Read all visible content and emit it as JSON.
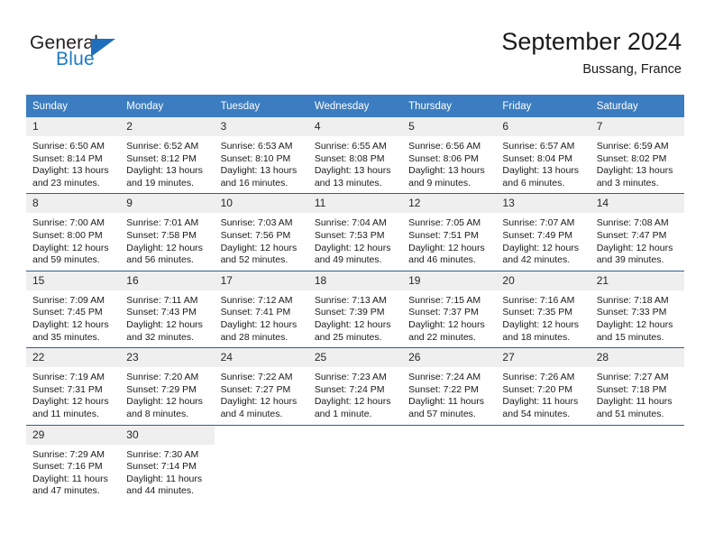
{
  "brand": {
    "name_top": "General",
    "name_bottom": "Blue",
    "color_dark": "#231f20",
    "color_blue": "#1f7ac4",
    "triangle_color": "#1f6fbd"
  },
  "header": {
    "title": "September 2024",
    "subtitle": "Bussang, France"
  },
  "theme": {
    "header_row_bg": "#3b7dc0",
    "header_row_text": "#ffffff",
    "daynum_bg": "#efefef",
    "row_divider": "#2f5f90"
  },
  "weekday_headers": [
    "Sunday",
    "Monday",
    "Tuesday",
    "Wednesday",
    "Thursday",
    "Friday",
    "Saturday"
  ],
  "labels": {
    "sunrise_prefix": "Sunrise:",
    "sunset_prefix": "Sunset:",
    "daylight_prefix": "Daylight:"
  },
  "weeks": [
    [
      {
        "day": "1",
        "sunrise": "Sunrise: 6:50 AM",
        "sunset": "Sunset: 8:14 PM",
        "daylight": "Daylight: 13 hours and 23 minutes."
      },
      {
        "day": "2",
        "sunrise": "Sunrise: 6:52 AM",
        "sunset": "Sunset: 8:12 PM",
        "daylight": "Daylight: 13 hours and 19 minutes."
      },
      {
        "day": "3",
        "sunrise": "Sunrise: 6:53 AM",
        "sunset": "Sunset: 8:10 PM",
        "daylight": "Daylight: 13 hours and 16 minutes."
      },
      {
        "day": "4",
        "sunrise": "Sunrise: 6:55 AM",
        "sunset": "Sunset: 8:08 PM",
        "daylight": "Daylight: 13 hours and 13 minutes."
      },
      {
        "day": "5",
        "sunrise": "Sunrise: 6:56 AM",
        "sunset": "Sunset: 8:06 PM",
        "daylight": "Daylight: 13 hours and 9 minutes."
      },
      {
        "day": "6",
        "sunrise": "Sunrise: 6:57 AM",
        "sunset": "Sunset: 8:04 PM",
        "daylight": "Daylight: 13 hours and 6 minutes."
      },
      {
        "day": "7",
        "sunrise": "Sunrise: 6:59 AM",
        "sunset": "Sunset: 8:02 PM",
        "daylight": "Daylight: 13 hours and 3 minutes."
      }
    ],
    [
      {
        "day": "8",
        "sunrise": "Sunrise: 7:00 AM",
        "sunset": "Sunset: 8:00 PM",
        "daylight": "Daylight: 12 hours and 59 minutes."
      },
      {
        "day": "9",
        "sunrise": "Sunrise: 7:01 AM",
        "sunset": "Sunset: 7:58 PM",
        "daylight": "Daylight: 12 hours and 56 minutes."
      },
      {
        "day": "10",
        "sunrise": "Sunrise: 7:03 AM",
        "sunset": "Sunset: 7:56 PM",
        "daylight": "Daylight: 12 hours and 52 minutes."
      },
      {
        "day": "11",
        "sunrise": "Sunrise: 7:04 AM",
        "sunset": "Sunset: 7:53 PM",
        "daylight": "Daylight: 12 hours and 49 minutes."
      },
      {
        "day": "12",
        "sunrise": "Sunrise: 7:05 AM",
        "sunset": "Sunset: 7:51 PM",
        "daylight": "Daylight: 12 hours and 46 minutes."
      },
      {
        "day": "13",
        "sunrise": "Sunrise: 7:07 AM",
        "sunset": "Sunset: 7:49 PM",
        "daylight": "Daylight: 12 hours and 42 minutes."
      },
      {
        "day": "14",
        "sunrise": "Sunrise: 7:08 AM",
        "sunset": "Sunset: 7:47 PM",
        "daylight": "Daylight: 12 hours and 39 minutes."
      }
    ],
    [
      {
        "day": "15",
        "sunrise": "Sunrise: 7:09 AM",
        "sunset": "Sunset: 7:45 PM",
        "daylight": "Daylight: 12 hours and 35 minutes."
      },
      {
        "day": "16",
        "sunrise": "Sunrise: 7:11 AM",
        "sunset": "Sunset: 7:43 PM",
        "daylight": "Daylight: 12 hours and 32 minutes."
      },
      {
        "day": "17",
        "sunrise": "Sunrise: 7:12 AM",
        "sunset": "Sunset: 7:41 PM",
        "daylight": "Daylight: 12 hours and 28 minutes."
      },
      {
        "day": "18",
        "sunrise": "Sunrise: 7:13 AM",
        "sunset": "Sunset: 7:39 PM",
        "daylight": "Daylight: 12 hours and 25 minutes."
      },
      {
        "day": "19",
        "sunrise": "Sunrise: 7:15 AM",
        "sunset": "Sunset: 7:37 PM",
        "daylight": "Daylight: 12 hours and 22 minutes."
      },
      {
        "day": "20",
        "sunrise": "Sunrise: 7:16 AM",
        "sunset": "Sunset: 7:35 PM",
        "daylight": "Daylight: 12 hours and 18 minutes."
      },
      {
        "day": "21",
        "sunrise": "Sunrise: 7:18 AM",
        "sunset": "Sunset: 7:33 PM",
        "daylight": "Daylight: 12 hours and 15 minutes."
      }
    ],
    [
      {
        "day": "22",
        "sunrise": "Sunrise: 7:19 AM",
        "sunset": "Sunset: 7:31 PM",
        "daylight": "Daylight: 12 hours and 11 minutes."
      },
      {
        "day": "23",
        "sunrise": "Sunrise: 7:20 AM",
        "sunset": "Sunset: 7:29 PM",
        "daylight": "Daylight: 12 hours and 8 minutes."
      },
      {
        "day": "24",
        "sunrise": "Sunrise: 7:22 AM",
        "sunset": "Sunset: 7:27 PM",
        "daylight": "Daylight: 12 hours and 4 minutes."
      },
      {
        "day": "25",
        "sunrise": "Sunrise: 7:23 AM",
        "sunset": "Sunset: 7:24 PM",
        "daylight": "Daylight: 12 hours and 1 minute."
      },
      {
        "day": "26",
        "sunrise": "Sunrise: 7:24 AM",
        "sunset": "Sunset: 7:22 PM",
        "daylight": "Daylight: 11 hours and 57 minutes."
      },
      {
        "day": "27",
        "sunrise": "Sunrise: 7:26 AM",
        "sunset": "Sunset: 7:20 PM",
        "daylight": "Daylight: 11 hours and 54 minutes."
      },
      {
        "day": "28",
        "sunrise": "Sunrise: 7:27 AM",
        "sunset": "Sunset: 7:18 PM",
        "daylight": "Daylight: 11 hours and 51 minutes."
      }
    ],
    [
      {
        "day": "29",
        "sunrise": "Sunrise: 7:29 AM",
        "sunset": "Sunset: 7:16 PM",
        "daylight": "Daylight: 11 hours and 47 minutes."
      },
      {
        "day": "30",
        "sunrise": "Sunrise: 7:30 AM",
        "sunset": "Sunset: 7:14 PM",
        "daylight": "Daylight: 11 hours and 44 minutes."
      },
      {
        "day": "",
        "sunrise": "",
        "sunset": "",
        "daylight": ""
      },
      {
        "day": "",
        "sunrise": "",
        "sunset": "",
        "daylight": ""
      },
      {
        "day": "",
        "sunrise": "",
        "sunset": "",
        "daylight": ""
      },
      {
        "day": "",
        "sunrise": "",
        "sunset": "",
        "daylight": ""
      },
      {
        "day": "",
        "sunrise": "",
        "sunset": "",
        "daylight": ""
      }
    ]
  ]
}
